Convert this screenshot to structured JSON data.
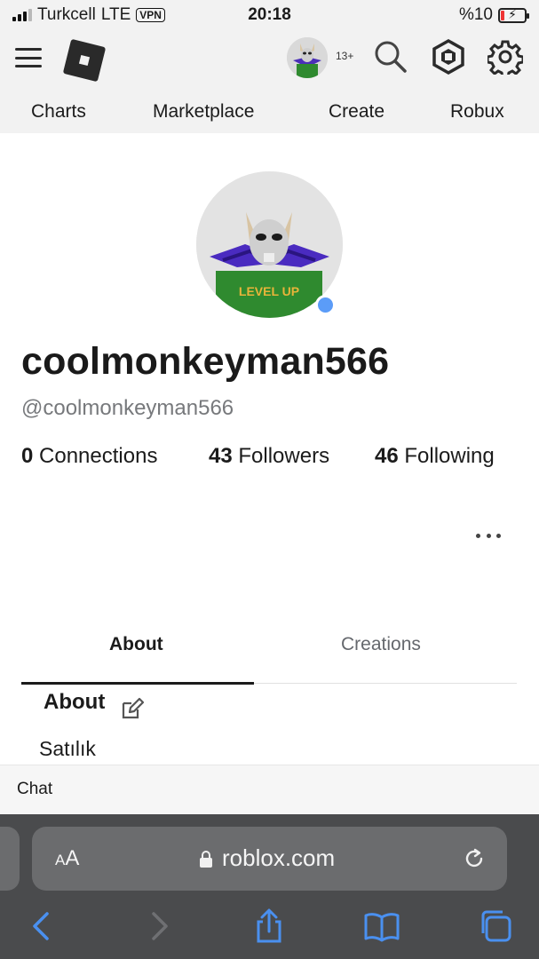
{
  "status_bar": {
    "carrier": "Turkcell",
    "network": "LTE",
    "vpn": "VPN",
    "time": "20:18",
    "battery": "%10"
  },
  "header": {
    "age_badge": "13+",
    "nav": [
      "Charts",
      "Marketplace",
      "Create",
      "Robux"
    ]
  },
  "profile": {
    "display_name": "coolmonkeyman566",
    "handle": "@coolmonkeyman566",
    "stats": {
      "connections_count": "0",
      "connections_label": "Connections",
      "followers_count": "43",
      "followers_label": "Followers",
      "following_count": "46",
      "following_label": "Following"
    },
    "online_status_color": "#5b9cf8"
  },
  "tabs": {
    "about": "About",
    "creations": "Creations",
    "active": "About"
  },
  "about": {
    "heading": "About",
    "text": "Satılık"
  },
  "chat": {
    "label": "Chat"
  },
  "browser": {
    "text_size_label": "AA",
    "url": "roblox.com"
  },
  "icons": {
    "menu": "hamburger-menu-icon",
    "logo": "roblox-logo-icon",
    "search": "search-icon",
    "robux": "robux-icon",
    "settings": "gear-icon",
    "edit": "edit-icon",
    "lock": "lock-icon",
    "reload": "reload-icon",
    "back": "chevron-left-icon",
    "forward": "chevron-right-icon",
    "share": "share-icon",
    "bookmarks": "book-icon",
    "tabs": "tabs-icon"
  }
}
